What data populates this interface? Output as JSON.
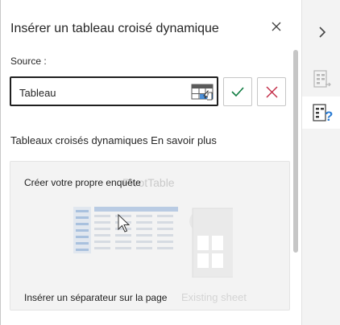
{
  "pane": {
    "title": "Insérer un tableau croisé dynamique",
    "close_icon": "close-icon"
  },
  "source": {
    "label": "Source :",
    "value": "Tableau",
    "range_picker_icon": "range-select-icon",
    "confirm_icon": "checkmark-icon",
    "cancel_icon": "x-icon"
  },
  "section": {
    "heading": "Tableaux croisés dynamiques",
    "learn_more": "En savoir plus"
  },
  "card": {
    "heading": "Créer votre propre enquête",
    "ghost_title": "PivotTable",
    "footer": "Insérer un séparateur sur la page",
    "ghost_footer": "Existing sheet",
    "illustration_icon": "pivot-table-illustration"
  },
  "sidebar": {
    "collapse_icon": "chevron-right-icon",
    "tabs": [
      {
        "name": "field-list-tab",
        "icon": "field-list-icon",
        "active": false
      },
      {
        "name": "recommended-tab",
        "icon": "pivot-help-icon",
        "active": true
      }
    ]
  },
  "colors": {
    "ok_green": "#107c41",
    "cancel_red": "#c4314b",
    "accent_blue": "#2b7cd3",
    "sidebar_bg": "#f3f3f3",
    "card_bg": "#f3f3f3"
  }
}
